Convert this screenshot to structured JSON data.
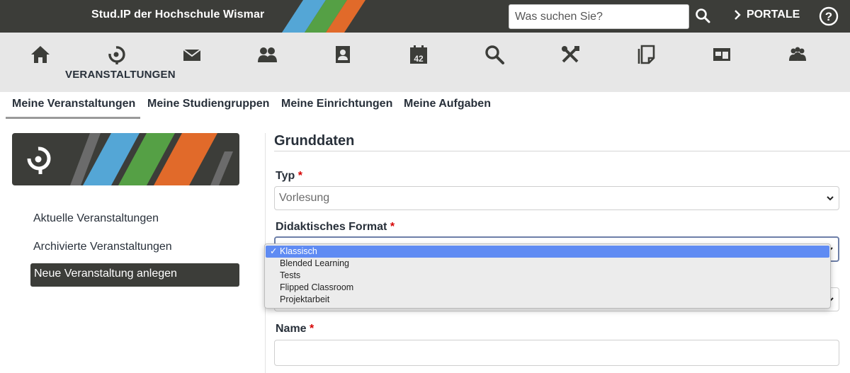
{
  "header": {
    "title": "Stud.IP der Hochschule Wismar",
    "search_placeholder": "Was suchen Sie?",
    "portale_label": "PORTALE",
    "stripe_colors": [
      "#54a6d6",
      "#55a045",
      "#e16a2a"
    ]
  },
  "nav": {
    "items": [
      "home-icon",
      "courses-icon",
      "mail-icon",
      "community-icon",
      "profile-icon",
      "calendar-icon",
      "search-icon",
      "tools-icon",
      "files-icon",
      "admin-icon",
      "groups-icon"
    ],
    "calendar_day": "42",
    "active_label": "VERANSTALTUNGEN"
  },
  "tabs": [
    "Meine Veranstaltungen",
    "Meine Studiengruppen",
    "Meine Einrichtungen",
    "Meine Aufgaben"
  ],
  "sidebar": {
    "links": [
      "Aktuelle Veranstaltungen",
      "Archivierte Veranstaltungen"
    ],
    "active_link": "Neue Veranstaltung anlegen"
  },
  "form": {
    "section_title": "Grunddaten",
    "typ_label": "Typ",
    "typ_value": "Vorlesung",
    "format_label": "Didaktisches Format",
    "name_label": "Name",
    "required_mark": "*"
  },
  "dropdown": {
    "options": [
      "Klassisch",
      "Blended Learning",
      "Tests",
      "Flipped Classroom",
      "Projektarbeit"
    ],
    "selected": "Klassisch",
    "check": "✓",
    "highlight_color": "#5f8bf3"
  }
}
